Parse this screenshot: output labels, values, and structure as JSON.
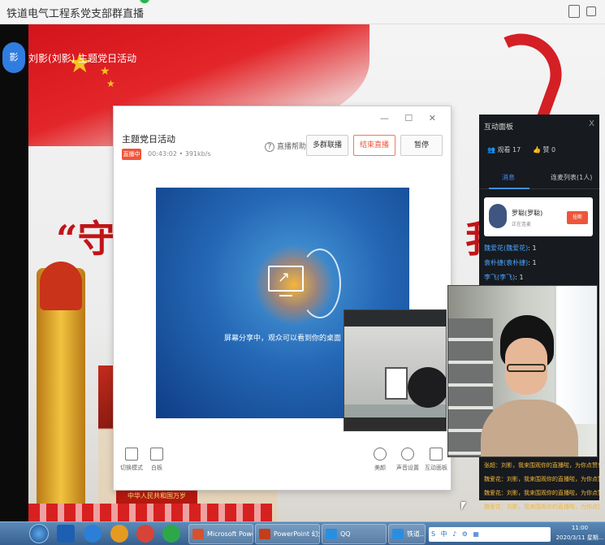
{
  "window": {
    "title": "铁道电气工程系党支部群直播"
  },
  "sidebar": {
    "avatar_text": "刘影",
    "avatar_text_short": "影"
  },
  "stream_banner": {
    "presenter_title": "刘影(刘影) 主题党日活动"
  },
  "slide": {
    "big_text_left": "“守初",
    "big_text_right": "我",
    "plaque": "中华人民共和国万岁"
  },
  "live_panel": {
    "window_buttons": "— ☐ ✕",
    "title": "主题党日活动",
    "live_badge": "直播中",
    "elapsed": "00:43:02",
    "bitrate": "391kb/s",
    "help_label": "直播帮助",
    "multi_group_button": "多群联播",
    "end_button": "结束直播",
    "pause_button": "暂停",
    "screen_share_text": "屏幕分享中，观众可以看到你的桌面",
    "tools": [
      {
        "label": "切换模式",
        "icon": "layout-grid-icon"
      },
      {
        "label": "白板",
        "icon": "whiteboard-icon"
      },
      {
        "label": "美颜",
        "icon": "beauty-face-icon"
      },
      {
        "label": "声音设置",
        "icon": "microphone-icon"
      },
      {
        "label": "互动面板",
        "icon": "chat-bubble-icon"
      }
    ]
  },
  "interaction_panel": {
    "title": "互动面板",
    "close": "X",
    "viewers": "观看 17",
    "likes": "赞 0",
    "tabs": {
      "messages": "消息",
      "queue": "连麦列表(1人)"
    },
    "mic_card": {
      "name": "罗聪(罗聪)",
      "status": "正在连麦",
      "hangup": "挂断"
    },
    "like_list": [
      {
        "name": "魏爱花(魏爱花)",
        "count": ": 1"
      },
      {
        "name": "袁朴捷(袁朴捷)",
        "count": ": 1"
      },
      {
        "name": "李飞(李飞)",
        "count": ": 1"
      }
    ],
    "chat_messages": [
      "张超：刘影，我来围观你的直播啦，为你点赞！",
      "魏爱花：刘影，我来围观你的直播啦，为你点赞！",
      "魏爱花：刘影，我来围观你的直播啦，为你点赞！",
      "魏爱花：刘影，我来围观你的直播啦，为你点赞！"
    ]
  },
  "taskbar": {
    "windows": [
      {
        "label": "Microsoft Powe...",
        "color": "#d35230"
      },
      {
        "label": "PowerPoint 幻灯...",
        "color": "#c43e1c"
      },
      {
        "label": "QQ",
        "color": "#2a8ee0"
      },
      {
        "label": "铁道...",
        "color": "#2a8ee0"
      }
    ],
    "tray_items": [
      "S",
      "中",
      "♪",
      "⚙",
      "▦"
    ],
    "clock_time": "11:00",
    "clock_date": "2020/3/11 星期..."
  }
}
